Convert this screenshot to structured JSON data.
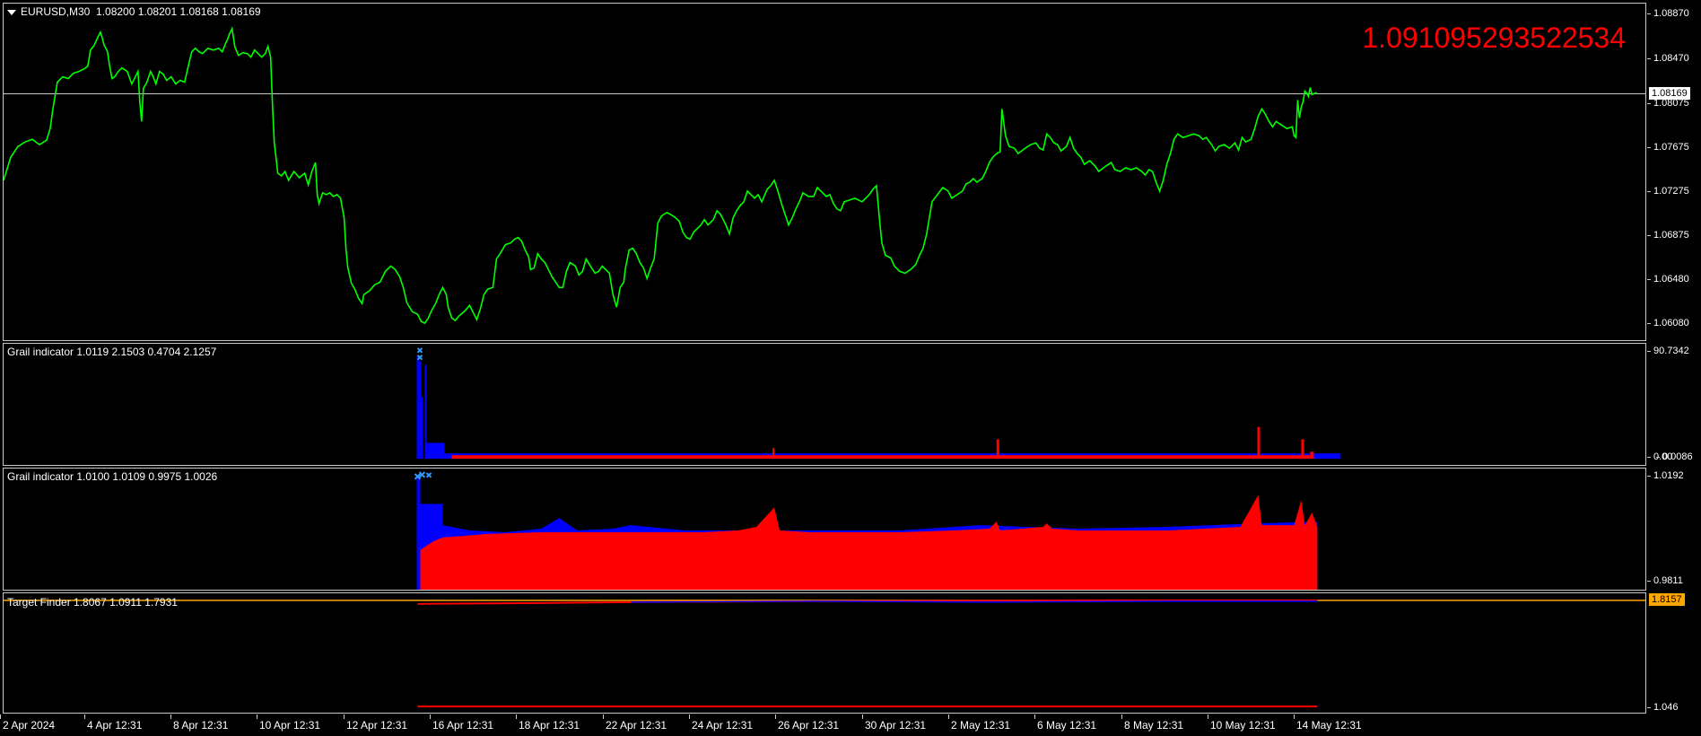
{
  "main_chart": {
    "symbol_label": "EURUSD,M30",
    "ohlc": "1.08200 1.08201 1.08168 1.08169",
    "big_value": "1.091095293522534",
    "current_price": "1.08169",
    "price_ticks": [
      "1.08870",
      "1.08470",
      "1.08075",
      "1.07675",
      "1.07275",
      "1.06875",
      "1.06480",
      "1.06080"
    ],
    "line_color": "#00ff00",
    "background": "#000000"
  },
  "indicator1": {
    "title": "Grail indicator 1.0119 2.1503 0.4704 2.1257",
    "ticks": [
      "90.7342",
      "0.0086"
    ],
    "overlap_tick": "0.00"
  },
  "indicator2": {
    "title": "Grail indicator 1.0100 1.0109 0.9975 1.0026",
    "ticks": [
      "1.0192",
      "0.9811"
    ]
  },
  "indicator3": {
    "title": "Target Finder 1.8067 1.0911 1.7931",
    "current_value": "1.8157",
    "ticks": [
      "1.046"
    ]
  },
  "time_axis": [
    "2 Apr 2024",
    "4 Apr 12:31",
    "8 Apr 12:31",
    "10 Apr 12:31",
    "12 Apr 12:31",
    "16 Apr 12:31",
    "18 Apr 12:31",
    "22 Apr 12:31",
    "24 Apr 12:31",
    "26 Apr 12:31",
    "30 Apr 12:31",
    "2 May 12:31",
    "6 May 12:31",
    "8 May 12:31",
    "10 May 12:31",
    "14 May 12:31"
  ],
  "colors": {
    "price_line": "#00ff00",
    "indicator_blue": "#0000ff",
    "indicator_red": "#ff0000",
    "marker": "#3399ff",
    "target_tag": "#ffa500",
    "big_value": "#ff0000"
  }
}
